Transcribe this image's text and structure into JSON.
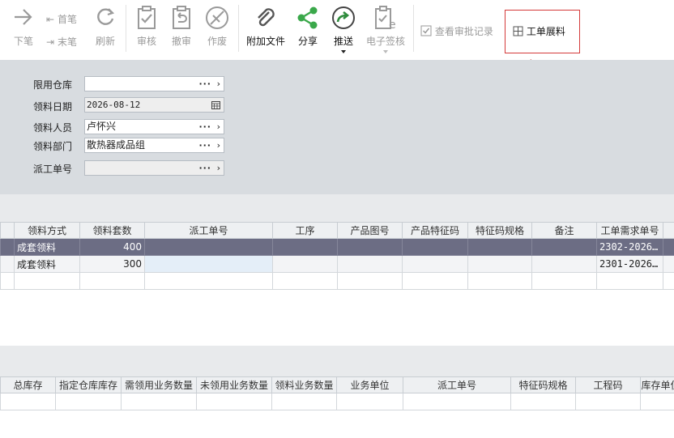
{
  "toolbar": {
    "nav": {
      "prev": "下笔",
      "first": "首笔",
      "next": "末笔",
      "last": "末笔"
    },
    "refresh": "刷新",
    "audit": "审核",
    "unaudit": "撤审",
    "void": "作废",
    "attach": "附加文件",
    "share": "分享",
    "push": "推送",
    "esign": "电子签核",
    "view_log": "查看审批记录",
    "workorder_expand": "工单展料"
  },
  "colors": {
    "accent_share": "#3aa84a",
    "accent_push": "#2e8b3c",
    "highlight": "#d43a3a",
    "selected_row": "#6c6d84"
  },
  "form": {
    "warehouse": {
      "label": "限用仓库",
      "value": ""
    },
    "date": {
      "label": "领料日期",
      "value": "2026-08-12"
    },
    "person": {
      "label": "领料人员",
      "value": "卢怀兴"
    },
    "dept": {
      "label": "领料部门",
      "value": "散热器成品组"
    },
    "workorder": {
      "label": "派工单号",
      "value": ""
    }
  },
  "grid1": {
    "headers": [
      "领料方式",
      "领料套数",
      "派工单号",
      "工序",
      "产品图号",
      "产品特征码",
      "特征码规格",
      "备注",
      "工单需求单号"
    ],
    "rows": [
      [
        "成套领料",
        "400",
        "",
        "",
        "",
        "",
        "",
        "",
        "2302-2026..."
      ],
      [
        "成套领料",
        "300",
        "",
        "",
        "",
        "",
        "",
        "",
        "2301-2026..."
      ]
    ]
  },
  "grid2": {
    "headers": [
      "总库存",
      "指定仓库库存",
      "需领用业务数量",
      "未领用业务数量",
      "领料业务数量",
      "业务单位",
      "派工单号",
      "特征码规格",
      "工程码",
      "库存单位"
    ]
  }
}
